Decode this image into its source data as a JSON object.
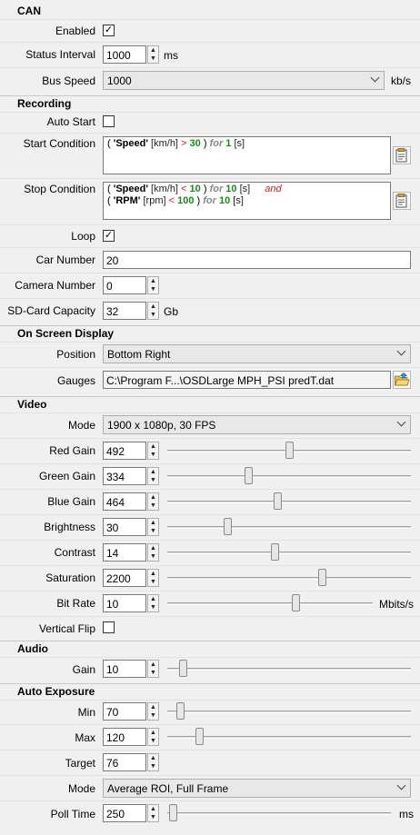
{
  "can": {
    "title": "CAN",
    "enabled_label": "Enabled",
    "enabled": true,
    "status_interval_label": "Status Interval",
    "status_interval_value": "1000",
    "status_interval_unit": "ms",
    "bus_speed_label": "Bus Speed",
    "bus_speed_value": "1000",
    "bus_speed_unit": "kb/s"
  },
  "recording": {
    "title": "Recording",
    "auto_start_label": "Auto Start",
    "auto_start": false,
    "start_condition_label": "Start Condition",
    "start_condition": {
      "open": "( ",
      "signal": "'Speed'",
      "unit": " [km/h] ",
      "op": ">",
      "value": " 30",
      "close": " ) ",
      "for": "for",
      "duration": " 1",
      "duration_unit": " [s]"
    },
    "stop_condition_label": "Stop Condition",
    "stop_condition": {
      "line1": {
        "open": "( ",
        "signal": "'Speed'",
        "unit": " [km/h] ",
        "op": "<",
        "value": " 10",
        "close": " ) ",
        "for": "for",
        "duration": " 10",
        "duration_unit": " [s]",
        "join": "and"
      },
      "line2": {
        "open": "( ",
        "signal": "'RPM'",
        "unit": " [rpm] ",
        "op": "<",
        "value": " 100",
        "close": " ) ",
        "for": "for",
        "duration": " 10",
        "duration_unit": " [s]"
      }
    },
    "loop_label": "Loop",
    "loop": true,
    "car_number_label": "Car Number",
    "car_number_value": "20",
    "camera_number_label": "Camera Number",
    "camera_number_value": "0",
    "sd_capacity_label": "SD-Card Capacity",
    "sd_capacity_value": "32",
    "sd_capacity_unit": "Gb"
  },
  "osd": {
    "title": "On Screen Display",
    "position_label": "Position",
    "position_value": "Bottom Right",
    "gauges_label": "Gauges",
    "gauges_value": "C:\\Program F...\\OSDLarge MPH_PSI predT.dat"
  },
  "video": {
    "title": "Video",
    "mode_label": "Mode",
    "mode_value": "1900 x 1080p, 30 FPS",
    "red_gain_label": "Red Gain",
    "red_gain_value": "492",
    "green_gain_label": "Green Gain",
    "green_gain_value": "334",
    "blue_gain_label": "Blue Gain",
    "blue_gain_value": "464",
    "brightness_label": "Brightness",
    "brightness_value": "30",
    "contrast_label": "Contrast",
    "contrast_value": "14",
    "saturation_label": "Saturation",
    "saturation_value": "2200",
    "bit_rate_label": "Bit Rate",
    "bit_rate_value": "10",
    "bit_rate_unit": "Mbits/s",
    "vertical_flip_label": "Vertical Flip",
    "vertical_flip": false
  },
  "audio": {
    "title": "Audio",
    "gain_label": "Gain",
    "gain_value": "10"
  },
  "auto_exposure": {
    "title": "Auto Exposure",
    "min_label": "Min",
    "min_value": "70",
    "max_label": "Max",
    "max_value": "120",
    "target_label": "Target",
    "target_value": "76",
    "mode_label": "Mode",
    "mode_value": "Average ROI, Full Frame",
    "poll_time_label": "Poll Time",
    "poll_time_value": "250",
    "poll_time_unit": "ms"
  },
  "slider_levels": {
    "red_gain": 0.5,
    "green_gain": 0.33,
    "blue_gain": 0.45,
    "brightness": 0.24,
    "contrast": 0.44,
    "saturation": 0.64,
    "bit_rate": 0.63,
    "audio_gain": 0.05,
    "ae_min": 0.04,
    "ae_max": 0.12,
    "poll_time": 0.01
  },
  "icons": {
    "spin_up": "▲",
    "spin_down": "▼",
    "check": "✓",
    "edit_icon": "edit-condition-icon",
    "folder_icon": "open-folder-icon"
  }
}
